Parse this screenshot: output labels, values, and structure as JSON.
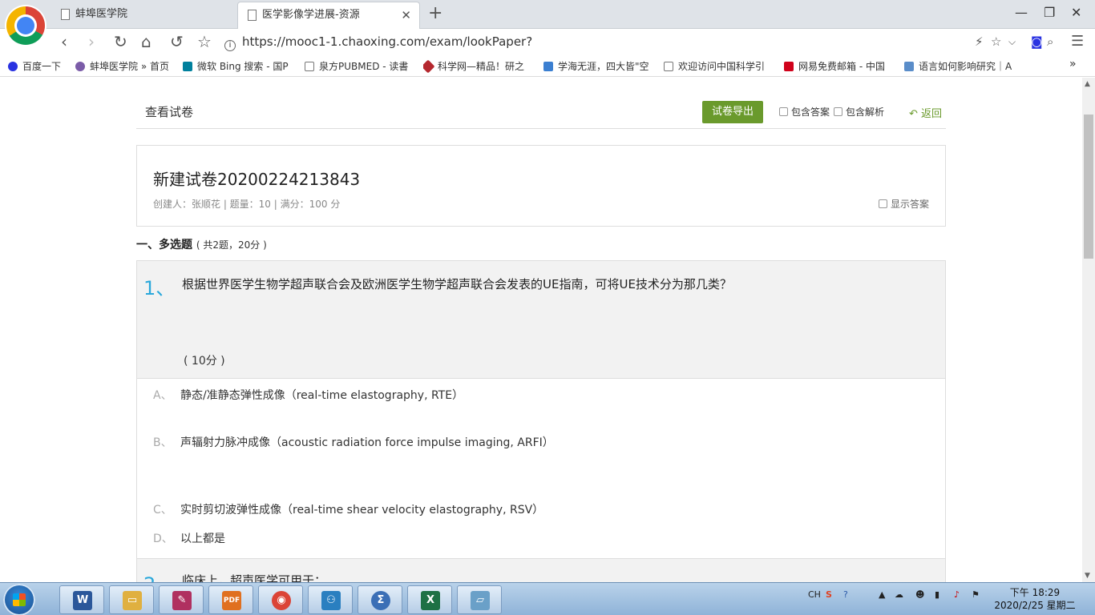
{
  "browser": {
    "tabs": [
      {
        "label": "蚌埠医学院"
      },
      {
        "label": "医学影像学进展-资源"
      }
    ],
    "new_tab": "+",
    "window_controls": {
      "minimize": "—",
      "restore": "❐",
      "close": "✕"
    },
    "nav": {
      "back": "‹",
      "forward": "›",
      "reload": "↻",
      "home": "⌂",
      "undo": "↺",
      "star": "☆"
    },
    "address": "https://mooc1-1.chaoxing.com/exam/lookPaper?classId=14896844&courseId=207427333&paperId=54569224&p=test&ut=t&enc=...",
    "bookmarks": [
      {
        "label": "百度一下",
        "color": "#2932e1"
      },
      {
        "label": "蚌埠医学院 » 首页",
        "color": "#7b5ca8"
      },
      {
        "label": "微软 Bing 搜索 - 国P",
        "color": "#00809d"
      },
      {
        "label": "泉方PUBMED - 读書",
        "color": "#ffffff"
      },
      {
        "label": "科学网—精品！研之",
        "color": "#b5282f"
      },
      {
        "label": "学海无涯，四大皆\"空",
        "color": "#3b7fd1"
      },
      {
        "label": "欢迎访问中国科学引",
        "color": "#ffffff"
      },
      {
        "label": "网易免费邮箱 - 中国",
        "color": "#d0021b"
      },
      {
        "label": "语言如何影响研究｜A",
        "color": "#5a8dc9"
      }
    ],
    "bookmarks_more": "»"
  },
  "page": {
    "title": "查看试卷",
    "export_button": "试卷导出",
    "include_answer": "包含答案",
    "include_analysis": "包含解析",
    "back": "返回",
    "paper": {
      "title": "新建试卷20200224213843",
      "meta": "创建人：张顺花 | 题量：10 | 满分：100 分",
      "show_answer": "显示答案"
    },
    "section": {
      "title": "一、多选题",
      "sub": "( 共2题，20分 )"
    },
    "questions": [
      {
        "number": "1、",
        "text": "根据世界医学生物学超声联合会及欧洲医学生物学超声联合会发表的UE指南，可将UE技术分为那几类？",
        "score": "( 10分 )",
        "options": [
          {
            "letter": "A、",
            "text": "静态/准静态弹性成像（real-time elastography, RTE）"
          },
          {
            "letter": "B、",
            "text": "声辐射力脉冲成像（acoustic radiation force impulse imaging, ARFI）"
          },
          {
            "letter": "C、",
            "text": "实时剪切波弹性成像（real-time shear velocity elastography, RSV）"
          },
          {
            "letter": "D、",
            "text": "以上都是"
          }
        ]
      },
      {
        "number": "2、",
        "text": "临床上，超声医学可用于："
      }
    ]
  },
  "taskbar": {
    "apps": [
      {
        "name": "word",
        "glyph": "W",
        "color": "#2b579a"
      },
      {
        "name": "explorer",
        "glyph": "▭",
        "color": "#e0b040"
      },
      {
        "name": "reader",
        "glyph": "✎",
        "color": "#b03060"
      },
      {
        "name": "pdf",
        "glyph": "PDF",
        "color": "#e07020"
      },
      {
        "name": "chrome",
        "glyph": "◉",
        "color": "#db4437"
      },
      {
        "name": "mindmap",
        "glyph": "⚇",
        "color": "#2a7fc0"
      },
      {
        "name": "mathtype",
        "glyph": "Σ",
        "color": "#3b6fb6"
      },
      {
        "name": "excel",
        "glyph": "X",
        "color": "#1e7145"
      },
      {
        "name": "notes",
        "glyph": "▱",
        "color": "#6aa0c8"
      }
    ],
    "tray": {
      "lang": "CH",
      "time_line1": "下午 18:29",
      "time_line2": "2020/2/25 星期二"
    }
  }
}
